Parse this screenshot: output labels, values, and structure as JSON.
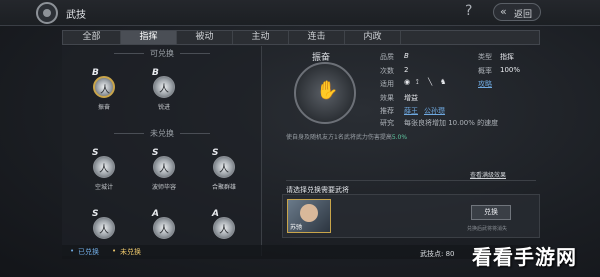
{
  "header": {
    "title": "武技",
    "help_label": "?",
    "back_label": "返回"
  },
  "tabs": [
    {
      "label": "全部",
      "active": false
    },
    {
      "label": "指挥",
      "active": true
    },
    {
      "label": "被动",
      "active": false
    },
    {
      "label": "主动",
      "active": false
    },
    {
      "label": "连击",
      "active": false
    },
    {
      "label": "内政",
      "active": false
    }
  ],
  "left": {
    "section_available": "可兑换",
    "section_unavailable": "未兑换",
    "skills": [
      {
        "grade": "B",
        "name": "振奋",
        "selected": true
      },
      {
        "grade": "B",
        "name": "锐进",
        "selected": false
      },
      {
        "grade": "S",
        "name": "空城计",
        "selected": false
      },
      {
        "grade": "S",
        "name": "波师毕容",
        "selected": false
      },
      {
        "grade": "S",
        "name": "合聚群雄",
        "selected": false
      },
      {
        "grade": "S",
        "name": "",
        "selected": false
      },
      {
        "grade": "A",
        "name": "",
        "selected": false
      },
      {
        "grade": "A",
        "name": "",
        "selected": false
      }
    ]
  },
  "detail": {
    "skill_name": "振奋",
    "labels": {
      "grade": "品质",
      "count": "次数",
      "apply": "适用",
      "effect": "效果",
      "recommend": "推荐",
      "research": "研究",
      "type": "类型",
      "chance": "概率"
    },
    "values": {
      "grade": "B",
      "count": "2",
      "effect": "增益",
      "type": "指挥",
      "chance": "100%"
    },
    "recommend_links": [
      "薛王",
      "公孙瓒"
    ],
    "research_text": "每张良将增加 10.00% 的速度",
    "strategy_link": "攻略",
    "apply_icons": [
      "shield-icon",
      "bow-icon",
      "spear-icon",
      "horse-icon"
    ],
    "description_prefix": "使自身及随机友方1名武将武力伤害提高",
    "description_value": "5.0%",
    "view_more": "查看满级效果",
    "select_prompt": "请选择兑换需要武将",
    "general_name": "苏驰",
    "swap_button": "兑换",
    "swap_note": "兑换后武将将消失"
  },
  "footer": {
    "legend_owned": "已兑换",
    "legend_unowned": "未兑换",
    "stat_label": "武技点",
    "stat_value": "80"
  },
  "watermark": "看看手游网",
  "colors": {
    "accent_gold": "#c9a54a",
    "link_blue": "#6fa9e0",
    "highlight_green": "#5fc6a0"
  }
}
